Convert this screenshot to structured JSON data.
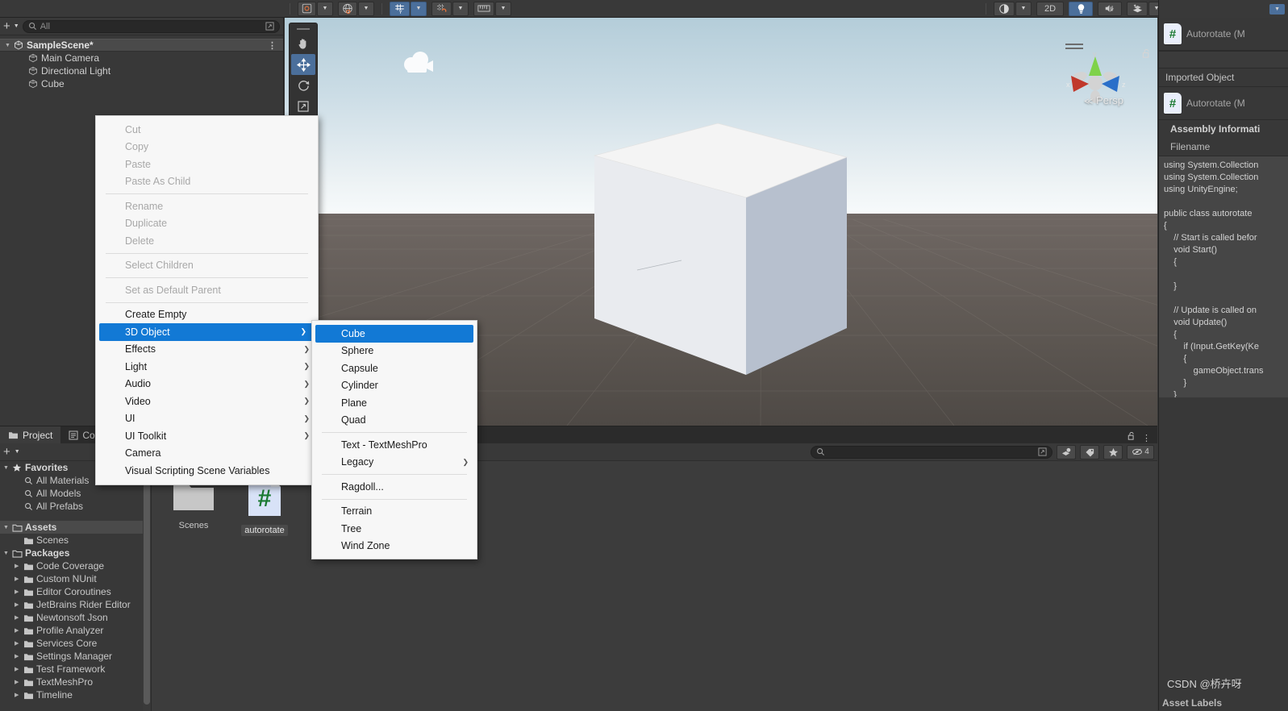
{
  "toolbar": {
    "left_groups": [
      {
        "name": "account-dropdown",
        "icon": "cloud-account-icon",
        "caret": true
      },
      {
        "name": "cloud-dropdown",
        "icon": "globe-icon",
        "caret": true
      }
    ],
    "center_groups": [
      {
        "name": "grid-snapping-toggle",
        "icon": "grid-y-icon",
        "active": true,
        "caret": true
      },
      {
        "name": "magnet-snap-toggle",
        "icon": "grid-magnet-icon",
        "active": false,
        "caret": true
      },
      {
        "name": "ruler-tool",
        "icon": "ruler-icon",
        "active": false,
        "caret": true
      }
    ],
    "right_groups": [
      {
        "name": "shading-mode-dropdown",
        "icon": "shaded-sphere-icon",
        "active": false,
        "caret": true
      },
      {
        "name": "2d-toggle",
        "label": "2D",
        "active": false
      },
      {
        "name": "lighting-toggle",
        "icon": "lightbulb-icon",
        "active": true
      },
      {
        "name": "audio-toggle",
        "icon": "speaker-mute-icon",
        "active": false
      },
      {
        "name": "effects-dropdown",
        "icon": "sparkle-layers-icon",
        "active": false,
        "caret": true
      },
      {
        "name": "scene-visibility-toggle",
        "icon": "eye-slash-icon",
        "active": true
      },
      {
        "name": "camera-dropdown",
        "icon": "camera-icon",
        "active": false,
        "caret": true
      },
      {
        "name": "gizmos-toggle",
        "icon": "gizmo-globe-icon",
        "active": true,
        "caret": true
      }
    ]
  },
  "hierarchy": {
    "add_button": "+",
    "search_placeholder": "All",
    "search_value": "",
    "scene_name": "SampleScene*",
    "menu_icon": "kebab-menu-icon",
    "items": [
      {
        "label": "Main Camera",
        "icon": "gameobject-cube-icon"
      },
      {
        "label": "Directional Light",
        "icon": "gameobject-cube-icon"
      },
      {
        "label": "Cube",
        "icon": "gameobject-cube-icon"
      }
    ]
  },
  "scene": {
    "tools": [
      {
        "name": "hand-tool",
        "icon": "hand-icon",
        "active": false
      },
      {
        "name": "move-tool",
        "icon": "move-arrows-icon",
        "active": true
      },
      {
        "name": "rotate-tool",
        "icon": "rotate-icon",
        "active": false
      },
      {
        "name": "scale-tool",
        "icon": "scale-icon",
        "active": false
      },
      {
        "name": "rect-tool",
        "icon": "rect-transform-icon",
        "active": false
      }
    ],
    "projection_label": "Persp",
    "gizmo_axes": [
      "x",
      "y",
      "z"
    ],
    "camera_gizmo_icon": "camera-gizmo-icon",
    "lock_icon": "lock-open-icon"
  },
  "context_menu": {
    "items": [
      {
        "label": "Cut",
        "enabled": false,
        "submenu": false
      },
      {
        "label": "Copy",
        "enabled": false,
        "submenu": false
      },
      {
        "label": "Paste",
        "enabled": false,
        "submenu": false
      },
      {
        "label": "Paste As Child",
        "enabled": false,
        "submenu": false
      },
      {
        "separator": true
      },
      {
        "label": "Rename",
        "enabled": false,
        "submenu": false
      },
      {
        "label": "Duplicate",
        "enabled": false,
        "submenu": false
      },
      {
        "label": "Delete",
        "enabled": false,
        "submenu": false
      },
      {
        "separator": true
      },
      {
        "label": "Select Children",
        "enabled": false,
        "submenu": false
      },
      {
        "separator": true
      },
      {
        "label": "Set as Default Parent",
        "enabled": false,
        "submenu": false
      },
      {
        "separator": true
      },
      {
        "label": "Create Empty",
        "enabled": true,
        "submenu": false
      },
      {
        "label": "3D Object",
        "enabled": true,
        "submenu": true,
        "highlighted": true
      },
      {
        "label": "Effects",
        "enabled": true,
        "submenu": true
      },
      {
        "label": "Light",
        "enabled": true,
        "submenu": true
      },
      {
        "label": "Audio",
        "enabled": true,
        "submenu": true
      },
      {
        "label": "Video",
        "enabled": true,
        "submenu": true
      },
      {
        "label": "UI",
        "enabled": true,
        "submenu": true
      },
      {
        "label": "UI Toolkit",
        "enabled": true,
        "submenu": true
      },
      {
        "label": "Camera",
        "enabled": true,
        "submenu": false
      },
      {
        "label": "Visual Scripting Scene Variables",
        "enabled": true,
        "submenu": false
      }
    ]
  },
  "submenu": {
    "items": [
      {
        "label": "Cube",
        "enabled": true,
        "submenu": false,
        "highlighted": true
      },
      {
        "label": "Sphere",
        "enabled": true,
        "submenu": false
      },
      {
        "label": "Capsule",
        "enabled": true,
        "submenu": false
      },
      {
        "label": "Cylinder",
        "enabled": true,
        "submenu": false
      },
      {
        "label": "Plane",
        "enabled": true,
        "submenu": false
      },
      {
        "label": "Quad",
        "enabled": true,
        "submenu": false
      },
      {
        "separator": true
      },
      {
        "label": "Text - TextMeshPro",
        "enabled": true,
        "submenu": false
      },
      {
        "label": "Legacy",
        "enabled": true,
        "submenu": true
      },
      {
        "separator": true
      },
      {
        "label": "Ragdoll...",
        "enabled": true,
        "submenu": false
      },
      {
        "separator": true
      },
      {
        "label": "Terrain",
        "enabled": true,
        "submenu": false
      },
      {
        "label": "Tree",
        "enabled": true,
        "submenu": false
      },
      {
        "label": "Wind Zone",
        "enabled": true,
        "submenu": false
      }
    ]
  },
  "project": {
    "tabs": [
      {
        "label": "Project",
        "icon": "folder-icon",
        "active": true
      },
      {
        "label": "Co",
        "icon": "console-icon",
        "active": false
      }
    ],
    "add_button": "+",
    "search_placeholder": "",
    "search_value": "",
    "right_icons": [
      {
        "name": "save-search-icon"
      },
      {
        "name": "package-filter-icon"
      },
      {
        "name": "label-filter-icon"
      },
      {
        "name": "favorite-star-icon"
      },
      {
        "name": "hidden-packages-icon"
      }
    ],
    "right_count": "4",
    "lock_icon": "lock-open-icon",
    "tree": [
      {
        "label": "Favorites",
        "depth": 0,
        "arrow": "open",
        "icon": "star-icon",
        "header": true
      },
      {
        "label": "All Materials",
        "depth": 1,
        "arrow": "none",
        "icon": "search-icon"
      },
      {
        "label": "All Models",
        "depth": 1,
        "arrow": "none",
        "icon": "search-icon"
      },
      {
        "label": "All Prefabs",
        "depth": 1,
        "arrow": "none",
        "icon": "search-icon"
      },
      {
        "label": "",
        "depth": 0,
        "arrow": "none",
        "icon": "none",
        "spacer": true
      },
      {
        "label": "Assets",
        "depth": 0,
        "arrow": "open",
        "icon": "folder-open-icon",
        "header": true,
        "selected": true
      },
      {
        "label": "Scenes",
        "depth": 1,
        "arrow": "none",
        "icon": "folder-icon"
      },
      {
        "label": "Packages",
        "depth": 0,
        "arrow": "open",
        "icon": "folder-open-icon",
        "header": true
      },
      {
        "label": "Code Coverage",
        "depth": 1,
        "arrow": "closed",
        "icon": "folder-icon"
      },
      {
        "label": "Custom NUnit",
        "depth": 1,
        "arrow": "closed",
        "icon": "folder-icon"
      },
      {
        "label": "Editor Coroutines",
        "depth": 1,
        "arrow": "closed",
        "icon": "folder-icon"
      },
      {
        "label": "JetBrains Rider Editor",
        "depth": 1,
        "arrow": "closed",
        "icon": "folder-icon"
      },
      {
        "label": "Newtonsoft Json",
        "depth": 1,
        "arrow": "closed",
        "icon": "folder-icon"
      },
      {
        "label": "Profile Analyzer",
        "depth": 1,
        "arrow": "closed",
        "icon": "folder-icon"
      },
      {
        "label": "Services Core",
        "depth": 1,
        "arrow": "closed",
        "icon": "folder-icon"
      },
      {
        "label": "Settings Manager",
        "depth": 1,
        "arrow": "closed",
        "icon": "folder-icon"
      },
      {
        "label": "Test Framework",
        "depth": 1,
        "arrow": "closed",
        "icon": "folder-icon"
      },
      {
        "label": "TextMeshPro",
        "depth": 1,
        "arrow": "closed",
        "icon": "folder-icon"
      },
      {
        "label": "Timeline",
        "depth": 1,
        "arrow": "closed",
        "icon": "folder-icon"
      }
    ],
    "assets": [
      {
        "label": "Scenes",
        "icon": "folder-icon",
        "selected": false
      },
      {
        "label": "autorotate",
        "icon": "csharp-script-icon",
        "selected": true
      }
    ]
  },
  "inspector": {
    "header_title": "Autorotate (M",
    "header_icon": "csharp-script-icon",
    "imported_object_label": "Imported Object",
    "object_title": "Autorotate (M",
    "object_icon": "csharp-script-icon",
    "assembly_info_label": "Assembly Informati",
    "filename_label": "Filename",
    "code": "using System.Collection\nusing System.Collection\nusing UnityEngine;\n\npublic class autorotate\n{\n    // Start is called befor\n    void Start()\n    {\n        \n    }\n\n    // Update is called on\n    void Update()\n    {\n        if (Input.GetKey(Ke\n        {\n            gameObject.trans\n        }\n    }\n}",
    "watermark": "CSDN @桥卉呀",
    "asset_labels": "Asset Labels",
    "dropdown_icon": "chevron-down-icon"
  },
  "colors": {
    "accent_blue": "#1279d5",
    "toolbar_active": "#4b6f9b",
    "panel_bg": "#383838",
    "menu_bg": "#f7f7f7",
    "csharp_green": "#1b7a32"
  }
}
